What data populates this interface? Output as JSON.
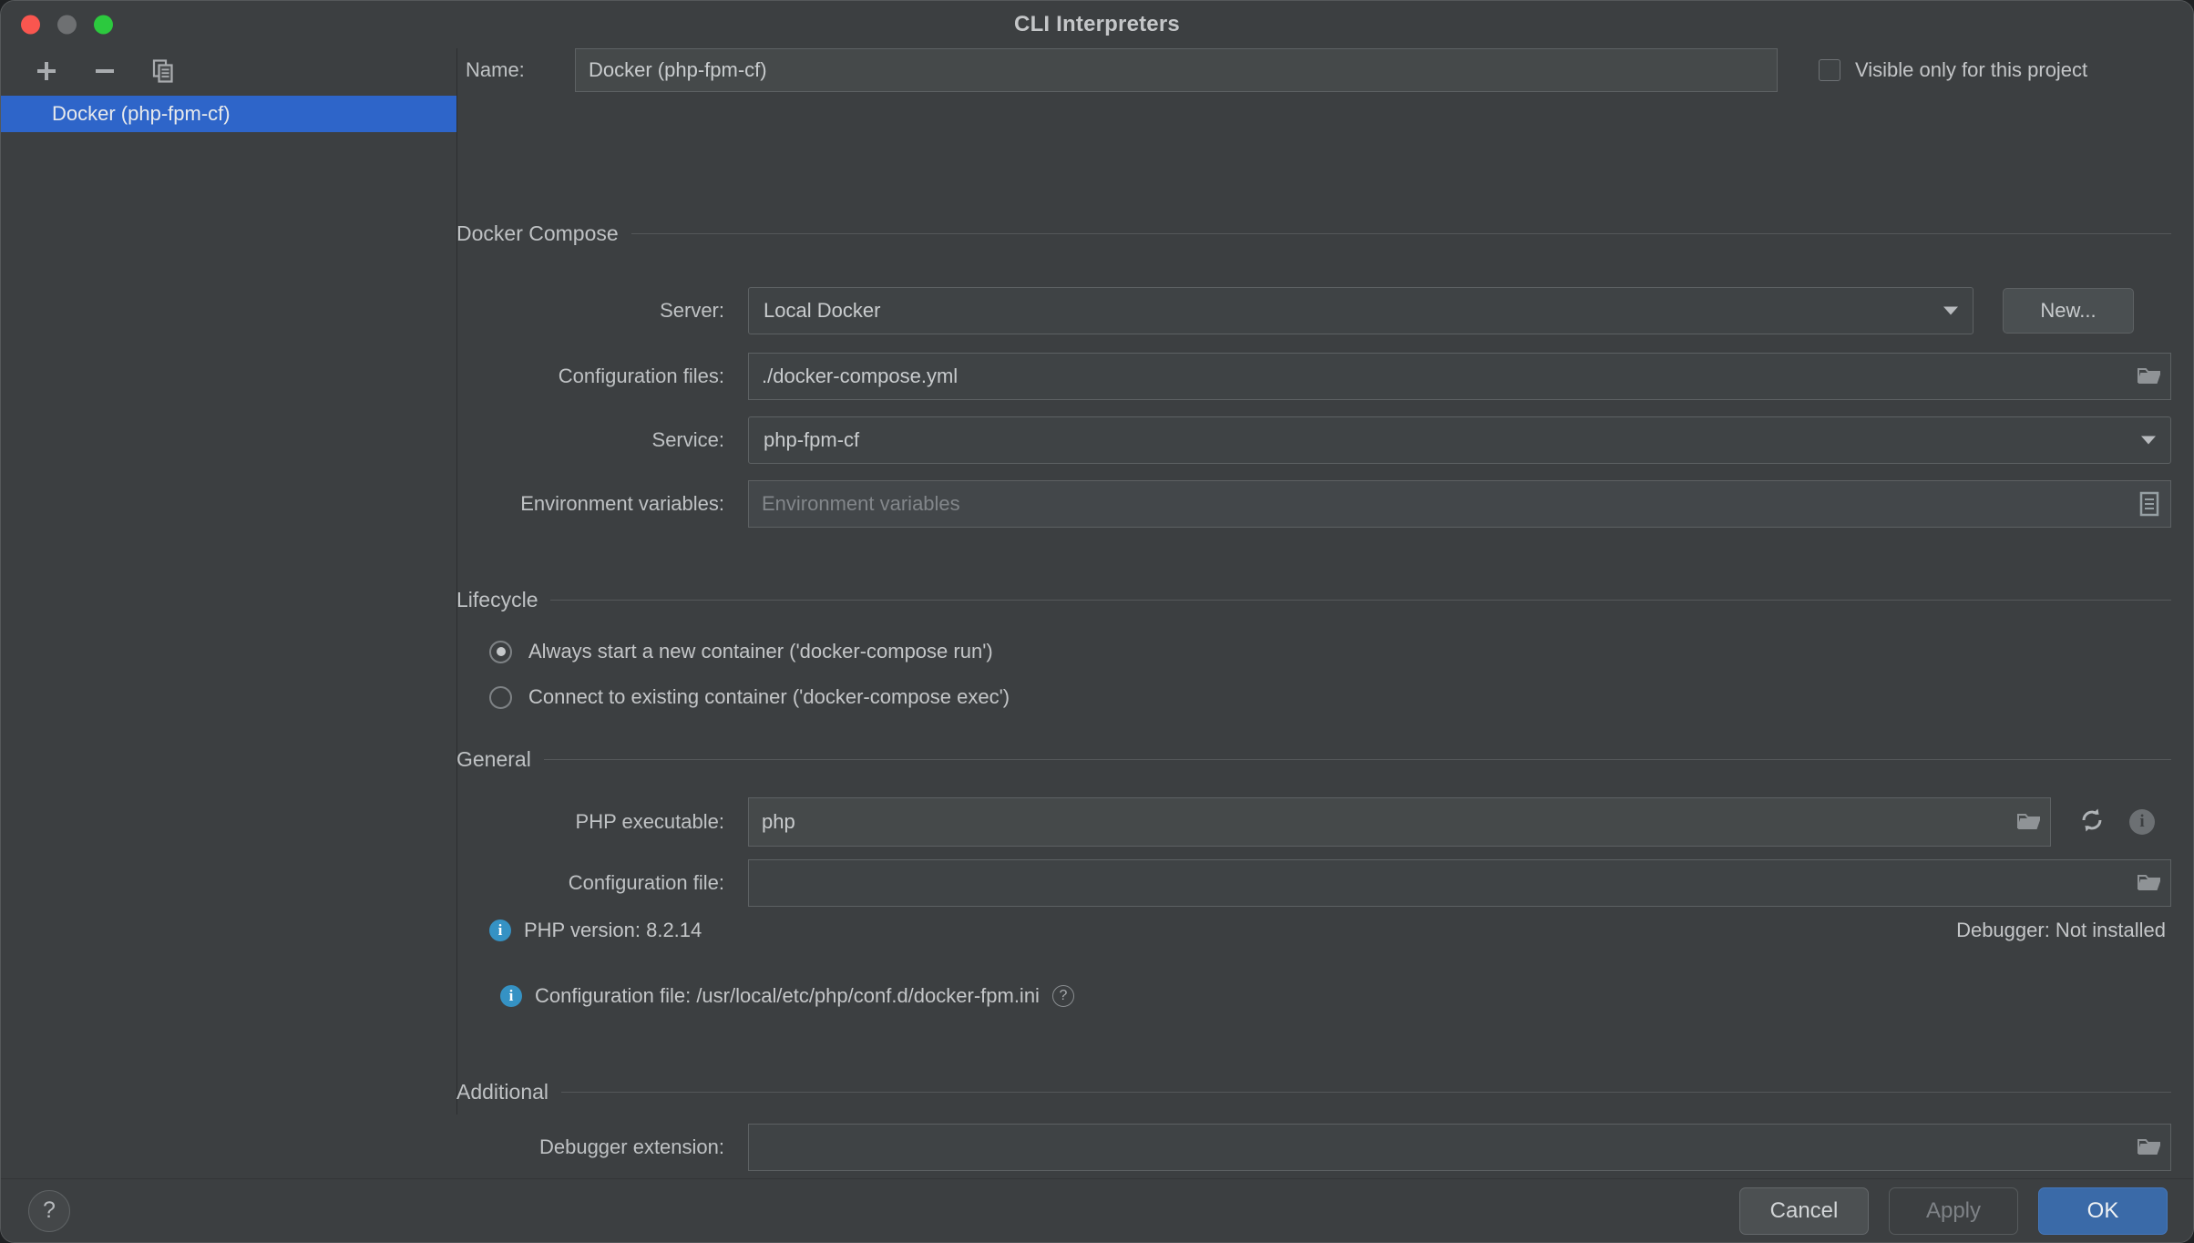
{
  "window": {
    "title": "CLI Interpreters",
    "traffic_lights": [
      "close-red",
      "minimize-yellow",
      "zoom-green"
    ]
  },
  "sidebar": {
    "toolbar": [
      {
        "name": "add-interpreter",
        "icon": "plus-icon"
      },
      {
        "name": "remove-interpreter",
        "icon": "minus-icon"
      },
      {
        "name": "duplicate-interpreter",
        "icon": "copy-icon"
      }
    ],
    "items": [
      {
        "label": "Docker (php-fpm-cf)",
        "selected": true
      }
    ]
  },
  "form": {
    "name_label": "Name:",
    "name_value": "Docker (php-fpm-cf)",
    "visible_only_label": "Visible only for this project",
    "visible_only_checked": false
  },
  "docker_compose": {
    "group_title": "Docker Compose",
    "server_label": "Server:",
    "server_value": "Local Docker",
    "new_button": "New...",
    "config_files_label": "Configuration files:",
    "config_files_value": "./docker-compose.yml",
    "service_label": "Service:",
    "service_value": "php-fpm-cf",
    "env_label": "Environment variables:",
    "env_value": "",
    "env_placeholder": "Environment variables"
  },
  "lifecycle": {
    "group_title": "Lifecycle",
    "options": [
      {
        "label": "Always start a new container ('docker-compose run')",
        "selected": true
      },
      {
        "label": "Connect to existing container ('docker-compose exec')",
        "selected": false
      }
    ]
  },
  "general": {
    "group_title": "General",
    "php_executable_label": "PHP executable:",
    "php_executable_value": "php",
    "config_file_label": "Configuration file:",
    "config_file_value": "",
    "php_version_text": "PHP version: 8.2.14",
    "debugger_text": "Debugger: Not installed",
    "config_file_info_text": "Configuration file: /usr/local/etc/php/conf.d/docker-fpm.ini"
  },
  "additional": {
    "group_title": "Additional",
    "debugger_extension_label": "Debugger extension:",
    "debugger_extension_value": ""
  },
  "bottom": {
    "help_label": "?",
    "cancel_label": "Cancel",
    "apply_label": "Apply",
    "ok_label": "OK"
  },
  "colors": {
    "window_bg": "#3c3f41",
    "selection_blue": "#2e65c9",
    "ok_blue": "#3a6aa8",
    "info_blue": "#3592c4",
    "field_bg": "#45494a",
    "text": "#c4c6c8"
  }
}
